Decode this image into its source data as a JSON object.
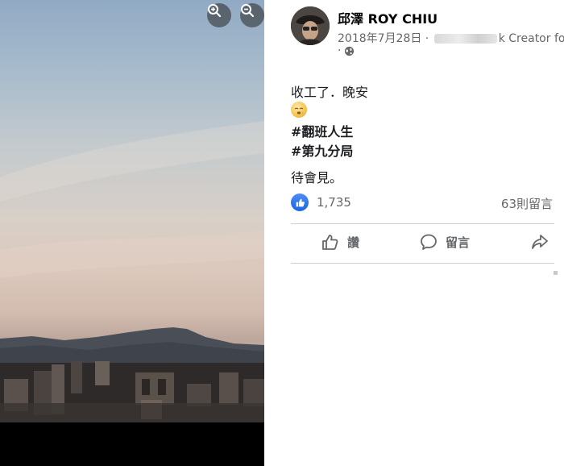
{
  "photo": {
    "zoom_in_icon": "zoom-in-icon",
    "zoom_out_icon": "zoom-out-icon"
  },
  "post": {
    "author_name": "邱澤 ROY CHIU",
    "date": "2018年7月28日 ·",
    "creator_suffix": "k Creator for",
    "privacy_prefix": "·",
    "privacy_icon": "globe-icon",
    "text_line1": "收工了．晚安",
    "text_line2": "待會見。",
    "hashtags": [
      "#翻班人生",
      "#第九分局"
    ],
    "like_count": "1,735",
    "comment_count": "63則留言",
    "actions": {
      "like": "讚",
      "comment": "留言",
      "share_icon": "share-icon"
    }
  },
  "colors": {
    "like_blue": "#1b66e0",
    "muted_text": "#65676b",
    "divider": "#ced0d4"
  }
}
